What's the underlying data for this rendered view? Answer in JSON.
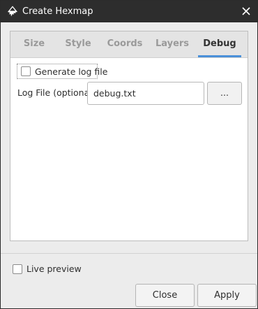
{
  "window": {
    "title": "Create Hexmap"
  },
  "icons": {
    "app": "inkscape-logo-icon",
    "close": "close-icon"
  },
  "tabs": [
    {
      "label": "Size",
      "active": false
    },
    {
      "label": "Style",
      "active": false
    },
    {
      "label": "Coords",
      "active": false
    },
    {
      "label": "Layers",
      "active": false
    },
    {
      "label": "Debug",
      "active": true
    }
  ],
  "debug": {
    "generate_log_label": "Generate log file",
    "generate_log_checked": false,
    "log_file_label": "Log File (optional)",
    "log_file_value": "debug.txt",
    "browse_label": "..."
  },
  "footer": {
    "live_preview_label": "Live preview",
    "live_preview_checked": false,
    "close_label": "Close",
    "apply_label": "Apply"
  },
  "colors": {
    "titlebar": "#2d2d2d",
    "accent": "#4a90d9",
    "panel": "#ececec"
  }
}
